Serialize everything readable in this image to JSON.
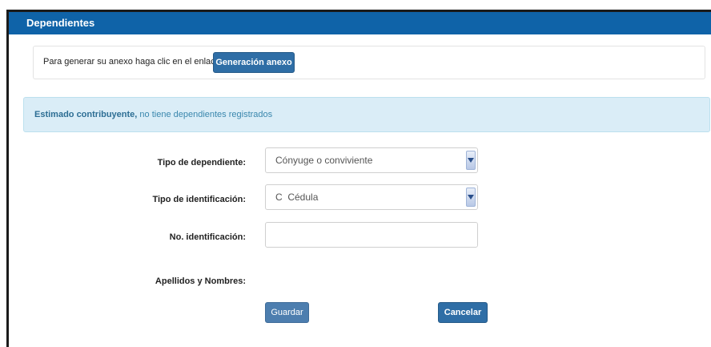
{
  "panel": {
    "title": "Dependientes"
  },
  "anexo": {
    "text": "Para generar su anexo haga clic en el enlace",
    "button_label": "Generación anexo"
  },
  "alert": {
    "strong": "Estimado contribuyente,",
    "text": " no tiene dependientes registrados"
  },
  "form": {
    "tipo_dependiente": {
      "label": "Tipo de dependiente:",
      "value": "Cónyuge o conviviente"
    },
    "tipo_identificacion": {
      "label": "Tipo de identificación:",
      "value": "C  Cédula"
    },
    "no_identificacion": {
      "label": "No. identificación:",
      "value": ""
    },
    "apellidos_nombres": {
      "label": "Apellidos y Nombres:"
    }
  },
  "actions": {
    "save_label": "Guardar",
    "cancel_label": "Cancelar"
  },
  "colors": {
    "header": "#0f63a8",
    "primary_button": "#2f6ea6",
    "alert_bg": "#daedf7",
    "alert_text": "#3a87ad"
  },
  "icons": {
    "select_arrow": "chevron-down-icon"
  }
}
